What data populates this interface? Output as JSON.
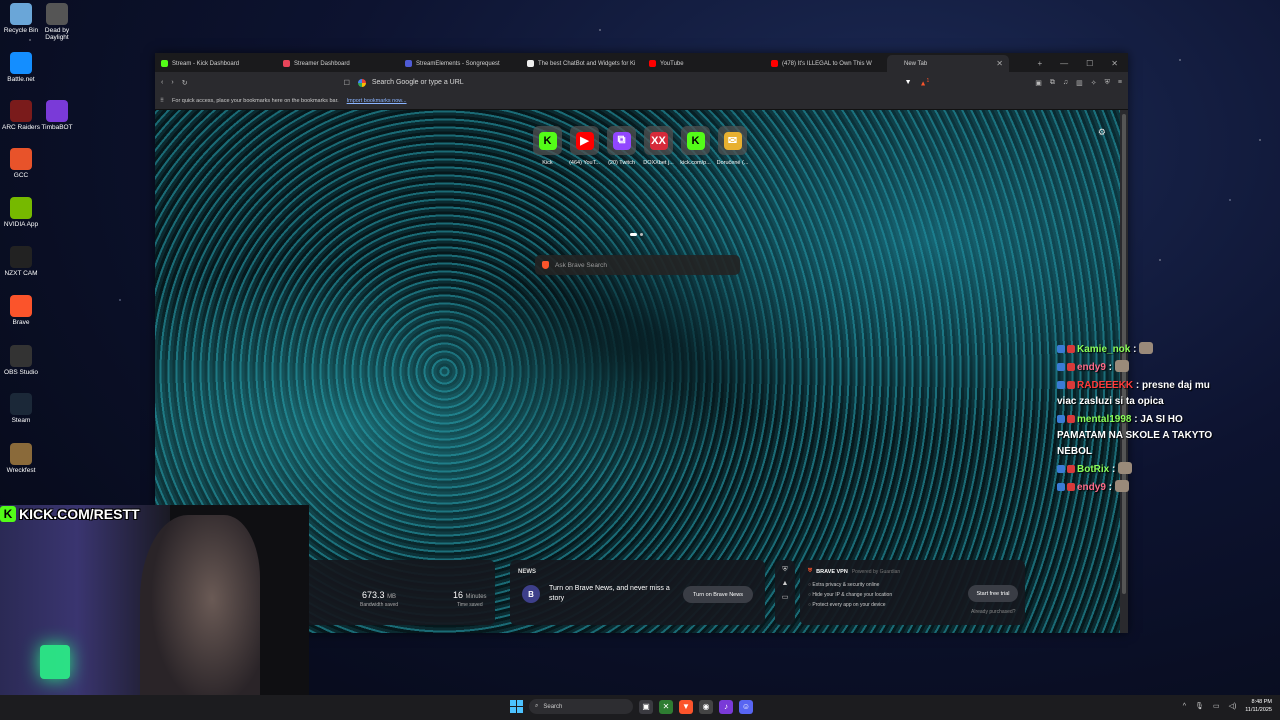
{
  "desktop_icons": [
    {
      "label": "Recycle Bin",
      "icon": "recycle-bin-icon",
      "color": "#6aa6d8"
    },
    {
      "label": "Dead by Daylight",
      "icon": "dead-by-daylight-icon",
      "color": "#555555"
    },
    {
      "label": "Battle.net",
      "icon": "battlenet-icon",
      "color": "#148eff"
    },
    {
      "label": "ARC Raiders",
      "icon": "arc-raiders-icon",
      "color": "#7a1b1b"
    },
    {
      "label": "TimbaBOT",
      "icon": "timbabot-icon",
      "color": "#7a3ad8"
    },
    {
      "label": "GCC",
      "icon": "gcc-icon",
      "color": "#e8532a"
    },
    {
      "label": "NVIDIA App",
      "icon": "nvidia-icon",
      "color": "#76b900"
    },
    {
      "label": "NZXT CAM",
      "icon": "nzxt-icon",
      "color": "#222222"
    },
    {
      "label": "Brave",
      "icon": "brave-icon",
      "color": "#fb542b"
    },
    {
      "label": "OBS Studio",
      "icon": "obs-icon",
      "color": "#333333"
    },
    {
      "label": "Steam",
      "icon": "steam-icon",
      "color": "#1b2838"
    },
    {
      "label": "Wreckfest",
      "icon": "wreckfest-icon",
      "color": "#8a6a3a"
    }
  ],
  "browser": {
    "tabs": [
      {
        "title": "Stream - Kick Dashboard",
        "fav": "#53fc18"
      },
      {
        "title": "Streamer Dashboard",
        "fav": "#e8455a"
      },
      {
        "title": "StreamElements - Songrequest",
        "fav": "#4f5bd5"
      },
      {
        "title": "The best ChatBot and Widgets for Ki",
        "fav": "#eeeeee"
      },
      {
        "title": "YouTube",
        "fav": "#ff0000"
      },
      {
        "title": "(478) It's ILLEGAL to Own This W",
        "fav": "#ff0000"
      },
      {
        "title": "New Tab",
        "fav": "#2a2a2e"
      }
    ],
    "address_placeholder": "Search Google or type a URL",
    "bookmarks_hint": "For quick access, place your bookmarks here on the bookmarks bar.",
    "bookmarks_link": "Import bookmarks now...",
    "shield_count": "1"
  },
  "newtab": {
    "tiles": [
      {
        "label": "Kick",
        "glyph": "K",
        "color": "#53fc18",
        "fg": "#000"
      },
      {
        "label": "(464) YouT...",
        "glyph": "▶",
        "color": "#ff0000",
        "fg": "#fff"
      },
      {
        "label": "(20) Twitch",
        "glyph": "⧉",
        "color": "#9146ff",
        "fg": "#fff"
      },
      {
        "label": "DOXXbet j...",
        "glyph": "XX",
        "color": "#d62a3a",
        "fg": "#fff"
      },
      {
        "label": "kick.com/p...",
        "glyph": "K",
        "color": "#53fc18",
        "fg": "#000"
      },
      {
        "label": "Doručené (...",
        "glyph": "✉",
        "color": "#e8b030",
        "fg": "#fff"
      }
    ],
    "search_placeholder": "Ask Brave Search",
    "stats": {
      "bandwidth_value": "673.3",
      "bandwidth_unit": "MB",
      "bandwidth_label": "Bandwidth saved",
      "time_value": "16",
      "time_unit": "Minutes",
      "time_label": "Time saved"
    },
    "news": {
      "heading": "NEWS",
      "avatar": "B",
      "text": "Turn on Brave News, and never miss a story",
      "button": "Turn on Brave News"
    },
    "vpn": {
      "title": "BRAVE VPN",
      "powered": "Powered by Guardian",
      "features": [
        "Extra privacy & security online",
        "Hide your IP & change your location",
        "Protect every app on your device"
      ],
      "button": "Start free trial",
      "already": "Already purchased?"
    }
  },
  "stream_overlay": {
    "kick_url": "KICK.COM/RESTT"
  },
  "chat": [
    {
      "user": "Kamie_nok",
      "color": "#8cff5a",
      "text": "",
      "emote": true
    },
    {
      "user": "endy9",
      "color": "#ff6b8a",
      "text": "",
      "emote": true
    },
    {
      "user": "RADEEEKK",
      "color": "#ff3b3b",
      "text": "presne daj mu viac zasluzi si ta opica",
      "emote": false
    },
    {
      "user": "mental1998",
      "color": "#8cff5a",
      "text": "JA SI HO PAMATAM NA SKOLE A TAKYTO NEBOL",
      "emote": false
    },
    {
      "user": "BotRix",
      "color": "#8cff5a",
      "text": "",
      "emote": true
    },
    {
      "user": "endy9",
      "color": "#ff6b8a",
      "text": "",
      "emote": true
    }
  ],
  "taskbar": {
    "search_label": "Search",
    "time": "8:48 PM",
    "date": "11/11/2025"
  }
}
